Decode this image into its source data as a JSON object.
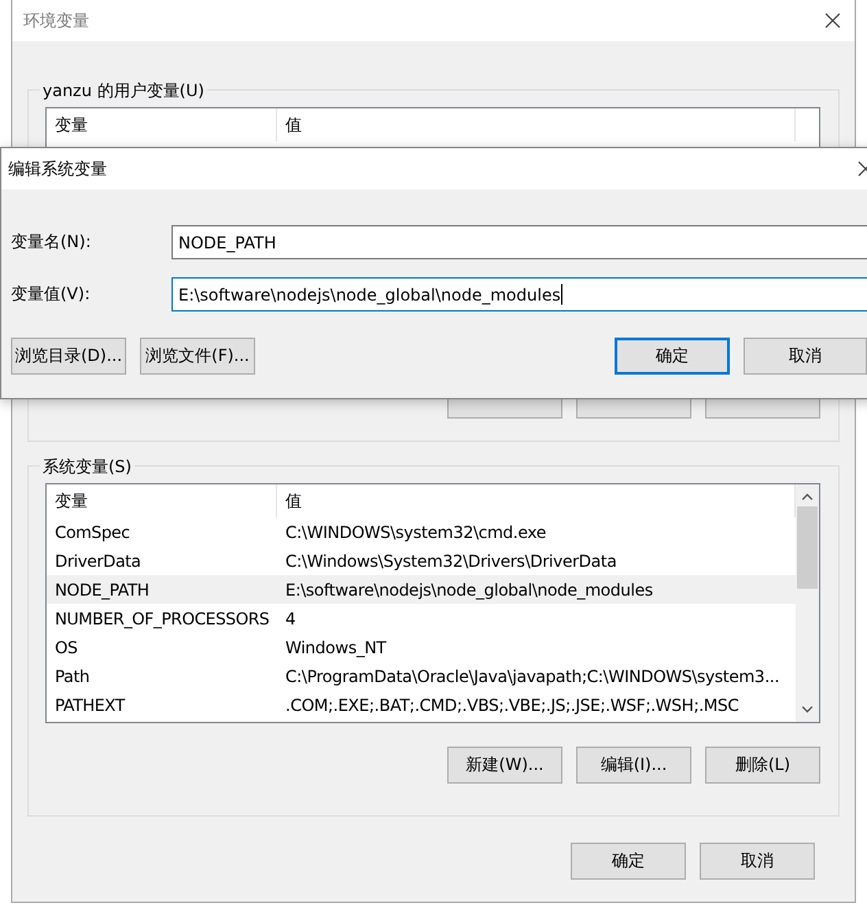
{
  "main_window": {
    "title": "环境变量",
    "user_vars": {
      "label": "yanzu 的用户变量(U)",
      "columns": [
        "变量",
        "值"
      ]
    },
    "system_vars": {
      "label": "系统变量(S)",
      "columns": [
        "变量",
        "值"
      ],
      "rows": [
        {
          "name": "ComSpec",
          "value": "C:\\WINDOWS\\system32\\cmd.exe",
          "selected": false
        },
        {
          "name": "DriverData",
          "value": "C:\\Windows\\System32\\Drivers\\DriverData",
          "selected": false
        },
        {
          "name": "NODE_PATH",
          "value": "E:\\software\\nodejs\\node_global\\node_modules",
          "selected": true
        },
        {
          "name": "NUMBER_OF_PROCESSORS",
          "value": "4",
          "selected": false
        },
        {
          "name": "OS",
          "value": "Windows_NT",
          "selected": false
        },
        {
          "name": "Path",
          "value": "C:\\ProgramData\\Oracle\\Java\\javapath;C:\\WINDOWS\\system3...",
          "selected": false
        },
        {
          "name": "PATHEXT",
          "value": ".COM;.EXE;.BAT;.CMD;.VBS;.VBE;.JS;.JSE;.WSF;.WSH;.MSC",
          "selected": false
        }
      ],
      "buttons": [
        "新建(W)...",
        "编辑(I)...",
        "删除(L)"
      ]
    },
    "buttons": [
      "确定",
      "取消"
    ]
  },
  "edit_dialog": {
    "title": "编辑系统变量",
    "fields": [
      {
        "label": "变量名(N):",
        "value": "NODE_PATH",
        "focused": false
      },
      {
        "label": "变量值(V):",
        "value": "E:\\software\\nodejs\\node_global\\node_modules",
        "focused": true
      }
    ],
    "browse_buttons": [
      {
        "label": "浏览目录(D)...",
        "default": false
      },
      {
        "label": "浏览文件(F)...",
        "default": false
      }
    ],
    "buttons": [
      {
        "label": "确定",
        "default": true
      },
      {
        "label": "取消",
        "default": false
      }
    ]
  }
}
